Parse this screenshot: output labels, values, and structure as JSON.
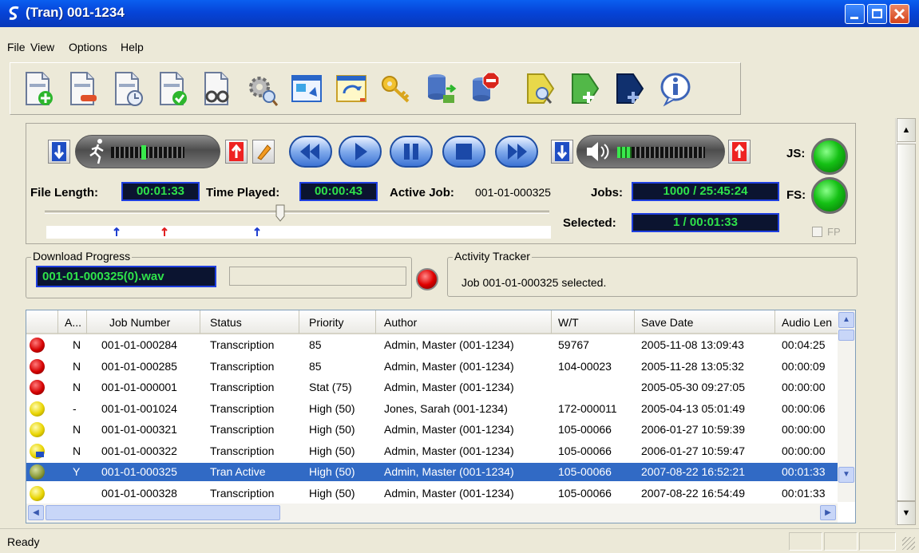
{
  "window": {
    "title": "(Tran) 001-1234"
  },
  "menu": {
    "file": "File",
    "view": "View",
    "options": "Options",
    "help": "Help"
  },
  "player": {
    "file_length_label": "File Length:",
    "file_length": "00:01:33",
    "time_played_label": "Time Played:",
    "time_played": "00:00:43",
    "active_job_label": "Active Job:",
    "active_job": "001-01-000325",
    "jobs_label": "Jobs:",
    "jobs": "1000 / 25:45:24",
    "selected_label": "Selected:",
    "selected": "1 / 00:01:33",
    "js_label": "JS:",
    "fs_label": "FS:",
    "fp_label": "FP"
  },
  "download": {
    "title": "Download Progress",
    "file": "001-01-000325(0).wav"
  },
  "activity": {
    "title": "Activity Tracker",
    "text": "Job 001-01-000325 selected."
  },
  "grid": {
    "columns": [
      "A...",
      "Job Number",
      "Status",
      "Priority",
      "Author",
      "W/T",
      "Save Date",
      "Audio Len"
    ],
    "rows": [
      [
        "N",
        "001-01-000284",
        "Transcription",
        "85",
        "Admin, Master (001-1234)",
        "59767",
        "2005-11-08 13:09:43",
        "00:04:25"
      ],
      [
        "N",
        "001-01-000285",
        "Transcription",
        "85",
        "Admin, Master (001-1234)",
        "104-00023",
        "2005-11-28 13:05:32",
        "00:00:09"
      ],
      [
        "N",
        "001-01-000001",
        "Transcription",
        "Stat (75)",
        "Admin, Master (001-1234)",
        "",
        "2005-05-30 09:27:05",
        "00:00:00"
      ],
      [
        "-",
        "001-01-001024",
        "Transcription",
        "High (50)",
        "Jones, Sarah (001-1234)",
        "172-000011",
        "2005-04-13 05:01:49",
        "00:00:06"
      ],
      [
        "N",
        "001-01-000321",
        "Transcription",
        "High (50)",
        "Admin, Master (001-1234)",
        "105-00066",
        "2006-01-27 10:59:39",
        "00:00:00"
      ],
      [
        "N",
        "001-01-000322",
        "Transcription",
        "High (50)",
        "Admin, Master (001-1234)",
        "105-00066",
        "2006-01-27 10:59:47",
        "00:00:00"
      ],
      [
        "Y",
        "001-01-000325",
        "Tran Active",
        "High (50)",
        "Admin, Master (001-1234)",
        "105-00066",
        "2007-08-22 16:52:21",
        "00:01:33"
      ],
      [
        "",
        "001-01-000328",
        "Transcription",
        "High (50)",
        "Admin, Master (001-1234)",
        "105-00066",
        "2007-08-22 16:54:49",
        "00:01:33"
      ]
    ],
    "row_icons": [
      "red",
      "red",
      "red",
      "yellow",
      "yellow",
      "yellow-blue",
      "olive",
      "yellow"
    ],
    "selected_row": 6
  },
  "status": {
    "text": "Ready"
  },
  "colors": {
    "title_blue": "#0644d8",
    "selection": "#316ac5",
    "lcd_text": "#2fe24a",
    "led_green": "#15c115",
    "led_red": "#e00000"
  },
  "icons": {
    "toolbar": [
      "new-job-icon",
      "remove-job-icon",
      "job-history-icon",
      "complete-job-icon",
      "view-job-icon",
      "settings-icon",
      "window-icon",
      "refresh-icon",
      "key-icon",
      "database-upload-icon",
      "stop-icon",
      "search-tag-icon",
      "add-tag-icon",
      "blue-tag-icon",
      "info-icon"
    ]
  }
}
